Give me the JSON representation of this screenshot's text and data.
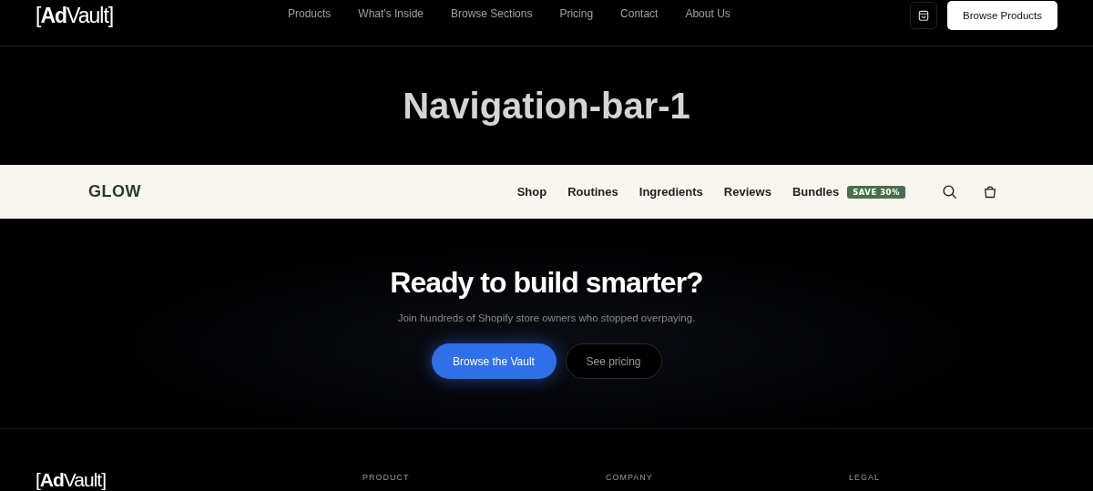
{
  "header": {
    "logo": "[**Ad**Vault]",
    "nav": [
      "Products",
      "What's Inside",
      "Browse Sections",
      "Pricing",
      "Contact",
      "About Us"
    ],
    "cta": "Browse Products"
  },
  "section_title": "Navigation-bar-1",
  "demo_nav": {
    "brand": "GLOW",
    "links": [
      {
        "label": "Shop"
      },
      {
        "label": "Routines"
      },
      {
        "label": "Ingredients"
      },
      {
        "label": "Reviews"
      },
      {
        "label": "Bundles",
        "badge": "SAVE 30%"
      }
    ]
  },
  "cta_section": {
    "title": "Ready to build smarter?",
    "subtitle": "Join hundreds of Shopify store owners who stopped overpaying.",
    "primary": "Browse the Vault",
    "secondary": "See pricing"
  },
  "footer": {
    "logo": "[**Ad**Vault]",
    "columns": [
      "PRODUCT",
      "COMPANY",
      "LEGAL"
    ]
  }
}
